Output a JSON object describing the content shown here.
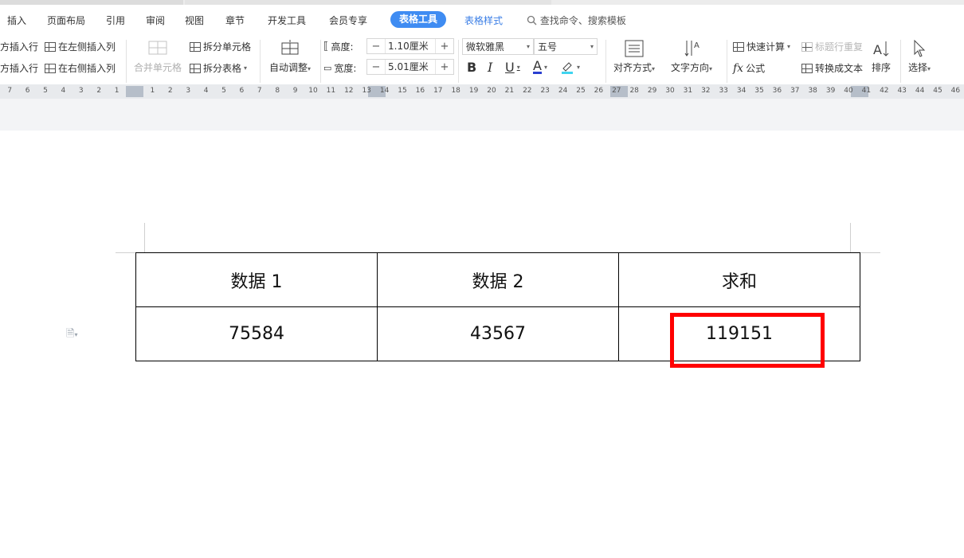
{
  "menu": {
    "items": [
      "插入",
      "页面布局",
      "引用",
      "审阅",
      "视图",
      "章节",
      "开发工具",
      "会员专享"
    ],
    "active_tab": "表格工具",
    "secondary_tab": "表格样式",
    "search": "查找命令、搜索模板"
  },
  "ribbon": {
    "insert_below": "方插入行",
    "insert_above": "方插入行",
    "insert_left_col": "在左侧插入列",
    "insert_right_col": "在右侧插入列",
    "merge_cells": "合并单元格",
    "split_cells": "拆分单元格",
    "split_table": "拆分表格",
    "auto_fit": "自动调整",
    "height_label": "高度:",
    "height_value": "1.10厘米",
    "width_label": "宽度:",
    "width_value": "5.01厘米",
    "font_name": "微软雅黑",
    "font_size": "五号",
    "bold": "B",
    "italic": "I",
    "underline": "U",
    "font_color": "A",
    "align": "对齐方式",
    "text_direction": "文字方向",
    "quick_calc": "快速计算",
    "formula": "公式",
    "repeat_header": "标题行重复",
    "convert_text": "转换成文本",
    "sort": "排序",
    "select": "选择"
  },
  "ruler": {
    "left_ticks": [
      "7",
      "6",
      "5",
      "4",
      "3",
      "2",
      "1"
    ],
    "right_ticks": [
      "1",
      "2",
      "3",
      "4",
      "5",
      "6",
      "7",
      "8",
      "9",
      "10",
      "11",
      "12",
      "13",
      "14",
      "15",
      "16",
      "17",
      "18",
      "19",
      "20",
      "21",
      "22",
      "23",
      "24",
      "25",
      "26",
      "27",
      "28",
      "29",
      "30",
      "31",
      "32",
      "33",
      "34",
      "35",
      "36",
      "37",
      "38",
      "39",
      "40",
      "41",
      "42",
      "43",
      "44",
      "45",
      "46"
    ]
  },
  "table": {
    "headers": [
      "数据 1",
      "数据 2",
      "求和"
    ],
    "row": [
      "75584",
      "43567",
      "119151"
    ]
  },
  "colors": {
    "accent": "#3f8cf2",
    "highlight_border": "#ff0000"
  }
}
